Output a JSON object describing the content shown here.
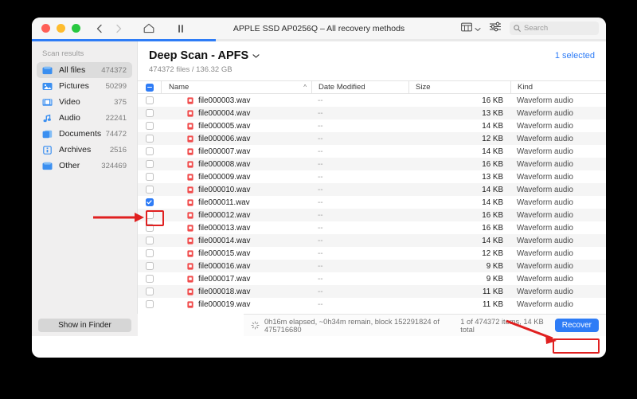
{
  "window": {
    "title": "APPLE SSD AP0256Q – All recovery methods",
    "traffic_lights": [
      "close",
      "minimize",
      "zoom"
    ]
  },
  "toolbar": {
    "back_icon": "chevron-left-icon",
    "forward_icon": "chevron-right-icon",
    "home_icon": "home-icon",
    "pause_icon": "pause-icon",
    "view_icon": "column-view-icon",
    "view_chevron": "chevron-down-icon",
    "settings_icon": "sliders-icon",
    "search_icon": "search-icon",
    "search_placeholder": "Search",
    "search_value": ""
  },
  "progress": {
    "percent": 32,
    "accent": "#2e7cf6"
  },
  "sidebar": {
    "title": "Scan results",
    "items": [
      {
        "label": "All files",
        "count": "474372",
        "icon": "folder-icon",
        "active": true
      },
      {
        "label": "Pictures",
        "count": "50299",
        "icon": "picture-icon",
        "active": false
      },
      {
        "label": "Video",
        "count": "375",
        "icon": "film-icon",
        "active": false
      },
      {
        "label": "Audio",
        "count": "22241",
        "icon": "music-note-icon",
        "active": false
      },
      {
        "label": "Documents",
        "count": "74472",
        "icon": "documents-icon",
        "active": false
      },
      {
        "label": "Archives",
        "count": "2516",
        "icon": "archive-icon",
        "active": false
      },
      {
        "label": "Other",
        "count": "324469",
        "icon": "folder-icon",
        "active": false
      }
    ],
    "show_in_finder_label": "Show in Finder"
  },
  "main": {
    "heading": "Deep Scan - APFS",
    "heading_chevron": "chevron-down-icon",
    "subheading": "474372 files / 136.32 GB",
    "selected_label": "1 selected"
  },
  "table": {
    "columns": {
      "check": "select-all",
      "name": "Name",
      "date_modified": "Date Modified",
      "size": "Size",
      "kind": "Kind"
    },
    "sort_indicator": "^",
    "header_checkbox_state": "indeterminate",
    "rows": [
      {
        "name": "file000003.wav",
        "date": "--",
        "size": "16 KB",
        "kind": "Waveform audio",
        "checked": false
      },
      {
        "name": "file000004.wav",
        "date": "--",
        "size": "13 KB",
        "kind": "Waveform audio",
        "checked": false
      },
      {
        "name": "file000005.wav",
        "date": "--",
        "size": "14 KB",
        "kind": "Waveform audio",
        "checked": false
      },
      {
        "name": "file000006.wav",
        "date": "--",
        "size": "12 KB",
        "kind": "Waveform audio",
        "checked": false
      },
      {
        "name": "file000007.wav",
        "date": "--",
        "size": "14 KB",
        "kind": "Waveform audio",
        "checked": false
      },
      {
        "name": "file000008.wav",
        "date": "--",
        "size": "16 KB",
        "kind": "Waveform audio",
        "checked": false
      },
      {
        "name": "file000009.wav",
        "date": "--",
        "size": "13 KB",
        "kind": "Waveform audio",
        "checked": false
      },
      {
        "name": "file000010.wav",
        "date": "--",
        "size": "14 KB",
        "kind": "Waveform audio",
        "checked": false
      },
      {
        "name": "file000011.wav",
        "date": "--",
        "size": "14 KB",
        "kind": "Waveform audio",
        "checked": true
      },
      {
        "name": "file000012.wav",
        "date": "--",
        "size": "16 KB",
        "kind": "Waveform audio",
        "checked": false
      },
      {
        "name": "file000013.wav",
        "date": "--",
        "size": "16 KB",
        "kind": "Waveform audio",
        "checked": false
      },
      {
        "name": "file000014.wav",
        "date": "--",
        "size": "14 KB",
        "kind": "Waveform audio",
        "checked": false
      },
      {
        "name": "file000015.wav",
        "date": "--",
        "size": "12 KB",
        "kind": "Waveform audio",
        "checked": false
      },
      {
        "name": "file000016.wav",
        "date": "--",
        "size": "9 KB",
        "kind": "Waveform audio",
        "checked": false
      },
      {
        "name": "file000017.wav",
        "date": "--",
        "size": "9 KB",
        "kind": "Waveform audio",
        "checked": false
      },
      {
        "name": "file000018.wav",
        "date": "--",
        "size": "11 KB",
        "kind": "Waveform audio",
        "checked": false
      },
      {
        "name": "file000019.wav",
        "date": "--",
        "size": "11 KB",
        "kind": "Waveform audio",
        "checked": false
      }
    ]
  },
  "statusbar": {
    "spinner_icon": "activity-spinner-icon",
    "progress_text": "0h16m elapsed, ~0h34m remain, block 152291824 of 475716680",
    "items_text": "1 of 474372 items, 14 KB total",
    "recover_label": "Recover"
  },
  "annotations": {
    "color": "#e02020",
    "arrow_to_checkbox": "arrow-right-icon",
    "arrow_to_recover": "arrow-down-right-icon",
    "box_checkbox": "highlight-box",
    "box_recover": "highlight-box"
  }
}
